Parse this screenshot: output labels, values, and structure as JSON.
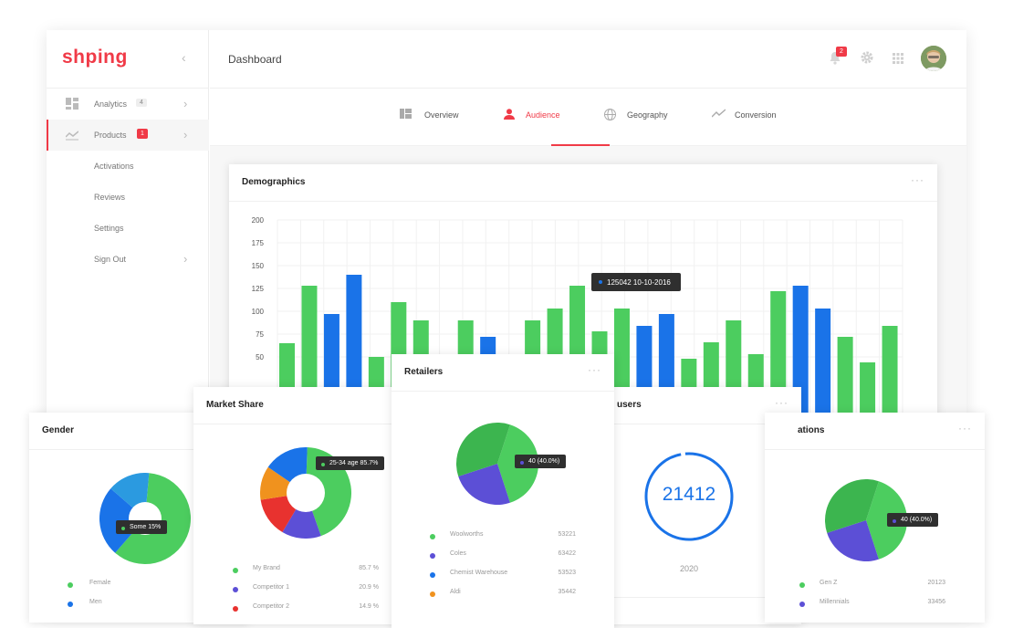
{
  "brand": {
    "logo": "shping"
  },
  "sidebar": {
    "items": [
      {
        "label": "Analytics",
        "badge": "4"
      },
      {
        "label": "Products",
        "badge": "1"
      },
      {
        "label": "Activations"
      },
      {
        "label": "Reviews"
      },
      {
        "label": "Settings"
      },
      {
        "label": "Sign Out"
      }
    ]
  },
  "header": {
    "title": "Dashboard",
    "notification_count": "2"
  },
  "tabs": [
    {
      "label": "Overview",
      "icon": "layout-icon"
    },
    {
      "label": "Audience",
      "icon": "user-icon",
      "active": true
    },
    {
      "label": "Geography",
      "icon": "globe-icon"
    },
    {
      "label": "Conversion",
      "icon": "trend-icon"
    }
  ],
  "colors": {
    "accent": "#f03a47",
    "green": "#4ccd5f",
    "blue": "#1a73e8",
    "purple": "#5c4fd6",
    "orange": "#f0921e",
    "red": "#e8322f",
    "sky": "#2b9ae0"
  },
  "demographics": {
    "title": "Demographics",
    "tooltip": "125042  10-10-2016",
    "chart_data": {
      "type": "bar",
      "yticks": [
        "200",
        "175",
        "150",
        "125",
        "100",
        "75",
        "50"
      ],
      "ylim": [
        0,
        200
      ],
      "values": [
        65,
        128,
        97,
        140,
        50,
        110,
        90,
        50,
        90,
        72,
        50,
        90,
        103,
        128,
        78,
        103,
        84,
        97,
        48,
        66,
        90,
        53,
        122,
        128,
        103,
        72,
        44,
        84
      ],
      "series_colors": [
        "green",
        "green",
        "blue",
        "blue",
        "green",
        "green",
        "green",
        "green",
        "green",
        "blue",
        "green",
        "green",
        "green",
        "green",
        "green",
        "green",
        "blue",
        "blue",
        "green",
        "green",
        "green",
        "green",
        "green",
        "blue",
        "blue",
        "green",
        "green",
        "green"
      ]
    }
  },
  "gender": {
    "title": "Gender",
    "tooltip": "Some 15%",
    "chart_data": {
      "type": "pie",
      "values": [
        60,
        25,
        15
      ],
      "colors": [
        "green",
        "blue",
        "sky"
      ]
    },
    "legend": [
      {
        "name": "Female",
        "color": "green"
      },
      {
        "name": "Men",
        "color": "blue"
      }
    ]
  },
  "market_share": {
    "title": "Market Share",
    "tooltip": "25-34 age 85.7%",
    "chart_data": {
      "type": "pie",
      "values": [
        44,
        14,
        14,
        12,
        16
      ],
      "colors": [
        "green",
        "purple",
        "red",
        "orange",
        "blue"
      ]
    },
    "legend": [
      {
        "name": "My Brand",
        "value": "85.7 %",
        "color": "green"
      },
      {
        "name": "Competitor 1",
        "value": "20.9 %",
        "color": "purple"
      },
      {
        "name": "Competitor 2",
        "value": "14.9 %",
        "color": "red"
      }
    ]
  },
  "retailers": {
    "title": "Retailers",
    "tooltip": "40 (40.0%)",
    "chart_data": {
      "type": "pie",
      "values": [
        40,
        25,
        35
      ],
      "colors": [
        "green",
        "purple",
        "greenDark"
      ]
    },
    "legend": [
      {
        "name": "Woolworths",
        "value": "53221",
        "color": "green"
      },
      {
        "name": "Coles",
        "value": "63422",
        "color": "purple"
      },
      {
        "name": "Chemist Warehouse",
        "value": "53523",
        "color": "blue"
      },
      {
        "name": "Aldi",
        "value": "35442",
        "color": "orange"
      }
    ]
  },
  "users": {
    "title": "users",
    "value": "21412",
    "year": "2020"
  },
  "generations": {
    "title": "ations",
    "tooltip": "40 (40.0%)",
    "chart_data": {
      "type": "pie",
      "values": [
        40,
        25,
        35
      ],
      "colors": [
        "green",
        "purple",
        "greenDark"
      ]
    },
    "legend": [
      {
        "name": "Gen Z",
        "value": "20123",
        "color": "green"
      },
      {
        "name": "Millennials",
        "value": "33456",
        "color": "purple"
      }
    ]
  }
}
